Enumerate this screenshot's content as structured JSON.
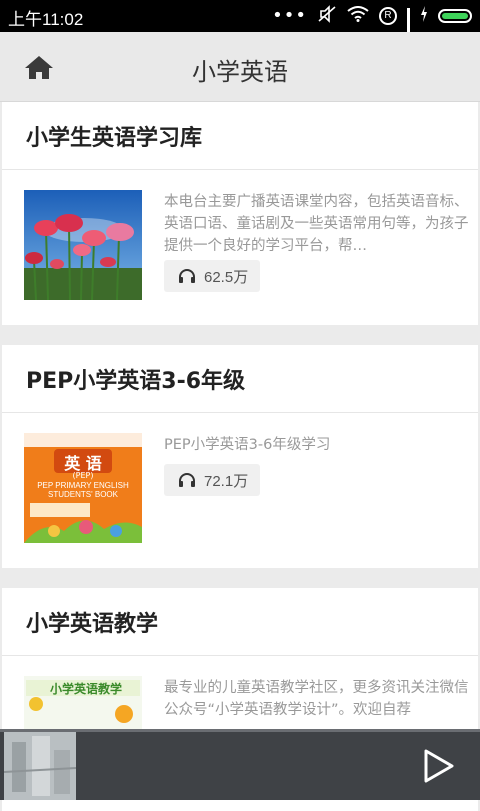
{
  "status_bar": {
    "time": "上午11:02"
  },
  "header": {
    "title": "小学英语"
  },
  "sections": [
    {
      "title": "小学生英语学习库",
      "item": {
        "description": "本电台主要广播英语课堂内容，包括英语音标、英语口语、童话剧及一些英语常用句等，为孩子提供一个良好的学习平台，帮…",
        "plays": "62.5万"
      }
    },
    {
      "title": "PEP小学英语3-6年级",
      "item": {
        "description": "PEP小学英语3-6年级学习",
        "plays": "72.1万",
        "cover_title": "英 语",
        "cover_sub": "(PEP)",
        "cover_en": "PEP PRIMARY ENGLISH STUDENTS' BOOK"
      }
    },
    {
      "title": "小学英语教学",
      "item": {
        "description": "最专业的儿童英语教学社区，更多资讯关注微信公众号“小学英语教学设计”。欢迎自荐",
        "cover_title": "小学英语教学"
      }
    }
  ],
  "icons": [
    "home-icon",
    "headphones-icon",
    "play-icon",
    "wifi-icon",
    "battery-icon"
  ],
  "colors": {
    "accent_battery": "#3ed35a",
    "player_bg": "#3f4246",
    "title_bar_bg": "#e9e9e9"
  }
}
